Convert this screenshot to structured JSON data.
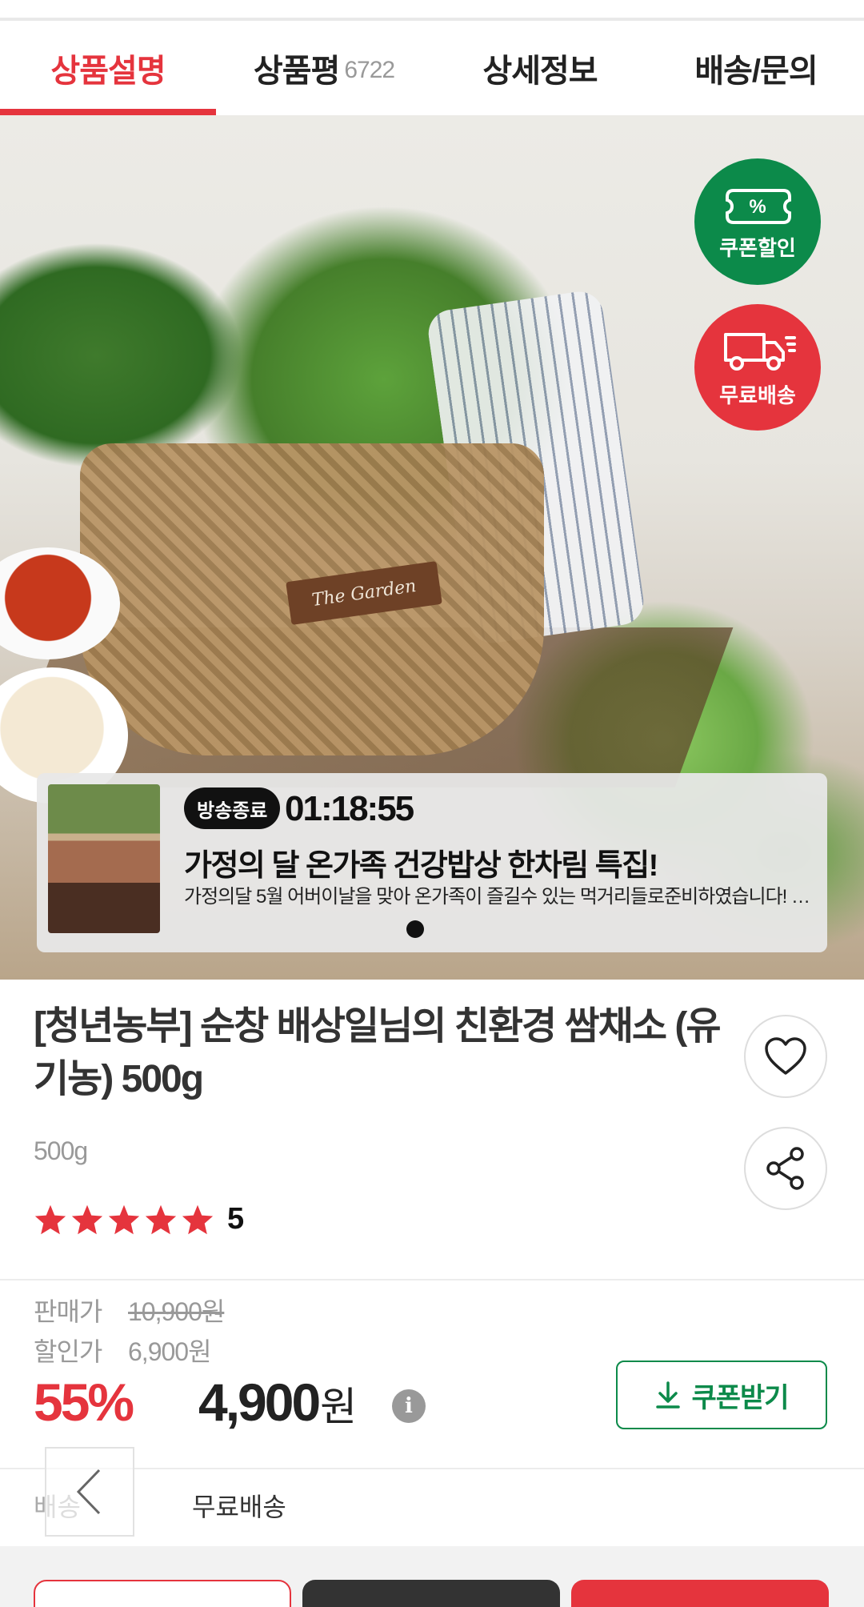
{
  "tabs": [
    {
      "label": "상품설명",
      "active": true
    },
    {
      "label": "상품평",
      "count": "6722"
    },
    {
      "label": "상세정보"
    },
    {
      "label": "배송/문의"
    }
  ],
  "hero": {
    "basket_tag": "The Garden",
    "badges": {
      "coupon": "쿠폰할인",
      "coupon_icon": "%",
      "shipping": "무료배송"
    }
  },
  "live": {
    "status": "방송종료",
    "time": "01:18:55",
    "title": "가정의 달 온가족 건강밥상 한차림 특집!",
    "description": "가정의달 5월 어버이날을 맞아 온가족이 즐길수 있는 먹거리들로준비하였습니다! 맛있게 즐겨주세요"
  },
  "product": {
    "title": "[청년농부] 순창 배상일님의 친환경 쌈채소 (유기농) 500g",
    "option": "500g",
    "rating": {
      "stars": 5,
      "value": "5"
    }
  },
  "price": {
    "sale_label": "판매가",
    "sale_price": "10,900원",
    "discount_label": "할인가",
    "discount_price": "6,900원",
    "rate": "55%",
    "final": "4,900",
    "final_unit": "원",
    "info_icon": "i",
    "coupon_button": "쿠폰받기"
  },
  "shipping": {
    "label": "배송",
    "value": "무료배송"
  },
  "colors": {
    "accent": "#e5343d",
    "green": "#0c8a4a",
    "star": "#e5343d"
  }
}
